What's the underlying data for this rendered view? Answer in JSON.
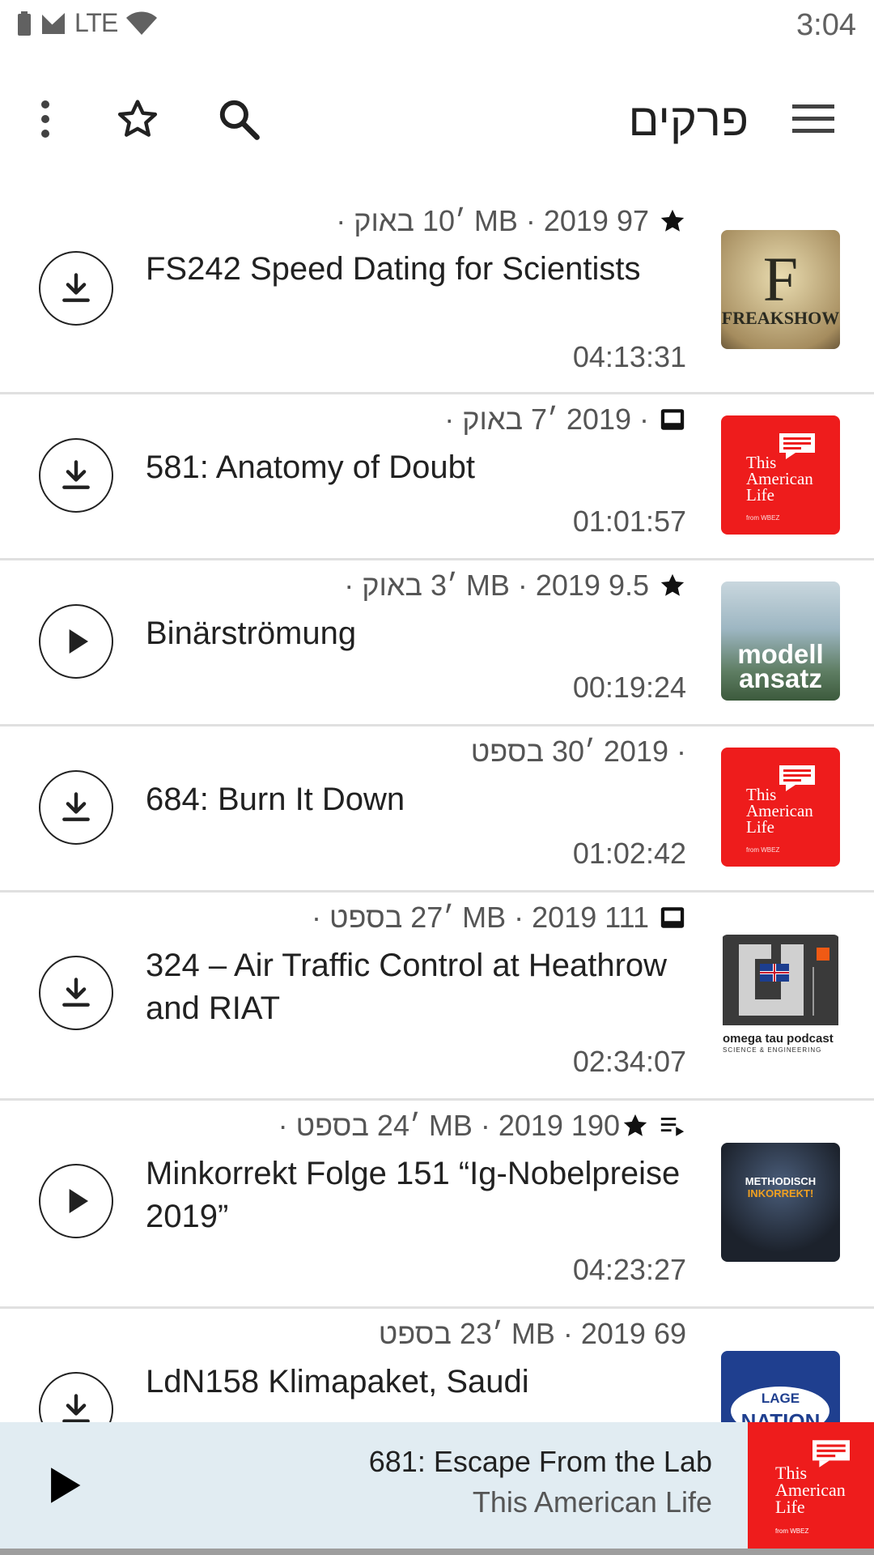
{
  "status": {
    "network": "LTE",
    "time": "3:04"
  },
  "toolbar": {
    "title": "פרקים"
  },
  "episodes": [
    {
      "meta": "97 MB · 2019 ׳10 באוק · ",
      "icon": "star-icon",
      "title": "FS242 Speed Dating for Scientists",
      "duration": "04:13:31",
      "action": "download",
      "thumb_text": [
        "F",
        "FREAKSHOW"
      ]
    },
    {
      "meta": "· 2019 ׳7 באוק · ",
      "icon": "inbox-icon",
      "title": "581: Anatomy of Doubt",
      "duration": "01:01:57",
      "action": "download",
      "thumb_text": [
        "This",
        "American",
        "Life",
        "from WBEZ"
      ]
    },
    {
      "meta": "9.5 MB · 2019 ׳3 באוק · ",
      "icon": "star-icon",
      "title": "Binärströmung",
      "duration": "00:19:24",
      "action": "play",
      "thumb_text": [
        "modell",
        "ansatz"
      ]
    },
    {
      "meta": "· 2019 ׳30 בספט",
      "icon": "",
      "title": "684: Burn It Down",
      "duration": "01:02:42",
      "action": "download",
      "thumb_text": [
        "This",
        "American",
        "Life",
        "from WBEZ"
      ]
    },
    {
      "meta": "111 MB · 2019 ׳27 בספט · ",
      "icon": "inbox-icon",
      "title": "324 – Air Traffic Control at Heathrow and RIAT",
      "duration": "02:34:07",
      "action": "download",
      "thumb_text": [
        "omega tau podcast",
        "SCIENCE & ENGINEERING"
      ]
    },
    {
      "meta": "190 MB · 2019 ׳24 בספט · ",
      "icon": "queue-star-icon",
      "title": "Minkorrekt Folge 151 “Ig-Nobelpreise 2019”",
      "duration": "04:23:27",
      "action": "play",
      "thumb_text": [
        "METHODISCH",
        "INKORREKT!"
      ]
    },
    {
      "meta": "69 MB · 2019 ׳23 בספט",
      "icon": "",
      "title": "LdN158 Klimapaket, Saudi",
      "duration": "",
      "action": "download",
      "thumb_text": [
        "LAGE",
        "DER",
        "NATION"
      ]
    }
  ],
  "player": {
    "title": "681: Escape From the Lab",
    "podcast": "This American Life",
    "cover_text": [
      "This",
      "American",
      "Life",
      "from WBEZ"
    ]
  },
  "colors": {
    "tal_red": "#ee1c1c",
    "player_bg": "#e1ecf2"
  }
}
